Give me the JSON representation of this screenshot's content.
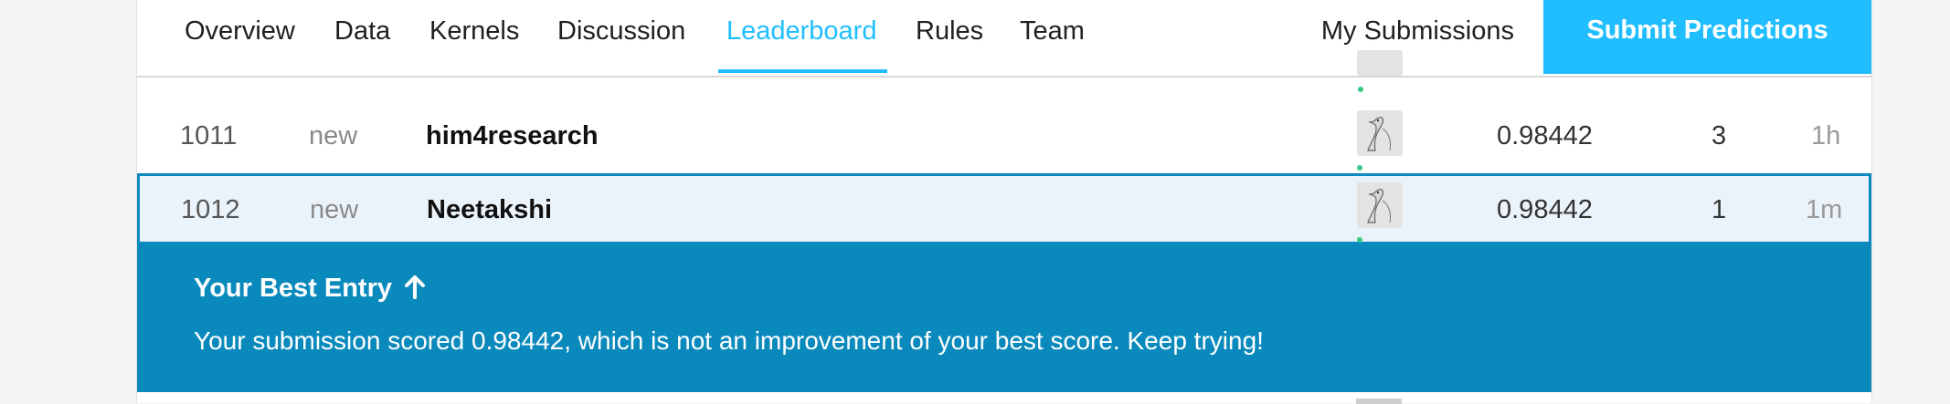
{
  "nav": {
    "tabs": [
      {
        "label": "Overview"
      },
      {
        "label": "Data"
      },
      {
        "label": "Kernels"
      },
      {
        "label": "Discussion"
      },
      {
        "label": "Leaderboard",
        "active": true
      },
      {
        "label": "Rules"
      },
      {
        "label": "Team"
      }
    ],
    "my_submissions": "My Submissions",
    "submit_button": "Submit Predictions"
  },
  "leaderboard": {
    "rows": [
      {
        "rank": "1011",
        "change": "new",
        "team": "him4research",
        "score": "0.98442",
        "entries": "3",
        "last": "1h"
      },
      {
        "rank": "1012",
        "change": "new",
        "team": "Neetakshi",
        "score": "0.98442",
        "entries": "1",
        "last": "1m"
      }
    ]
  },
  "best_entry": {
    "title": "Your Best Entry",
    "message": "Your submission scored 0.98442, which is not an improvement of your best score. Keep trying!"
  },
  "colors": {
    "accent": "#20beff",
    "banner": "#0a8abc",
    "highlight_row": "#eaf3fa"
  }
}
